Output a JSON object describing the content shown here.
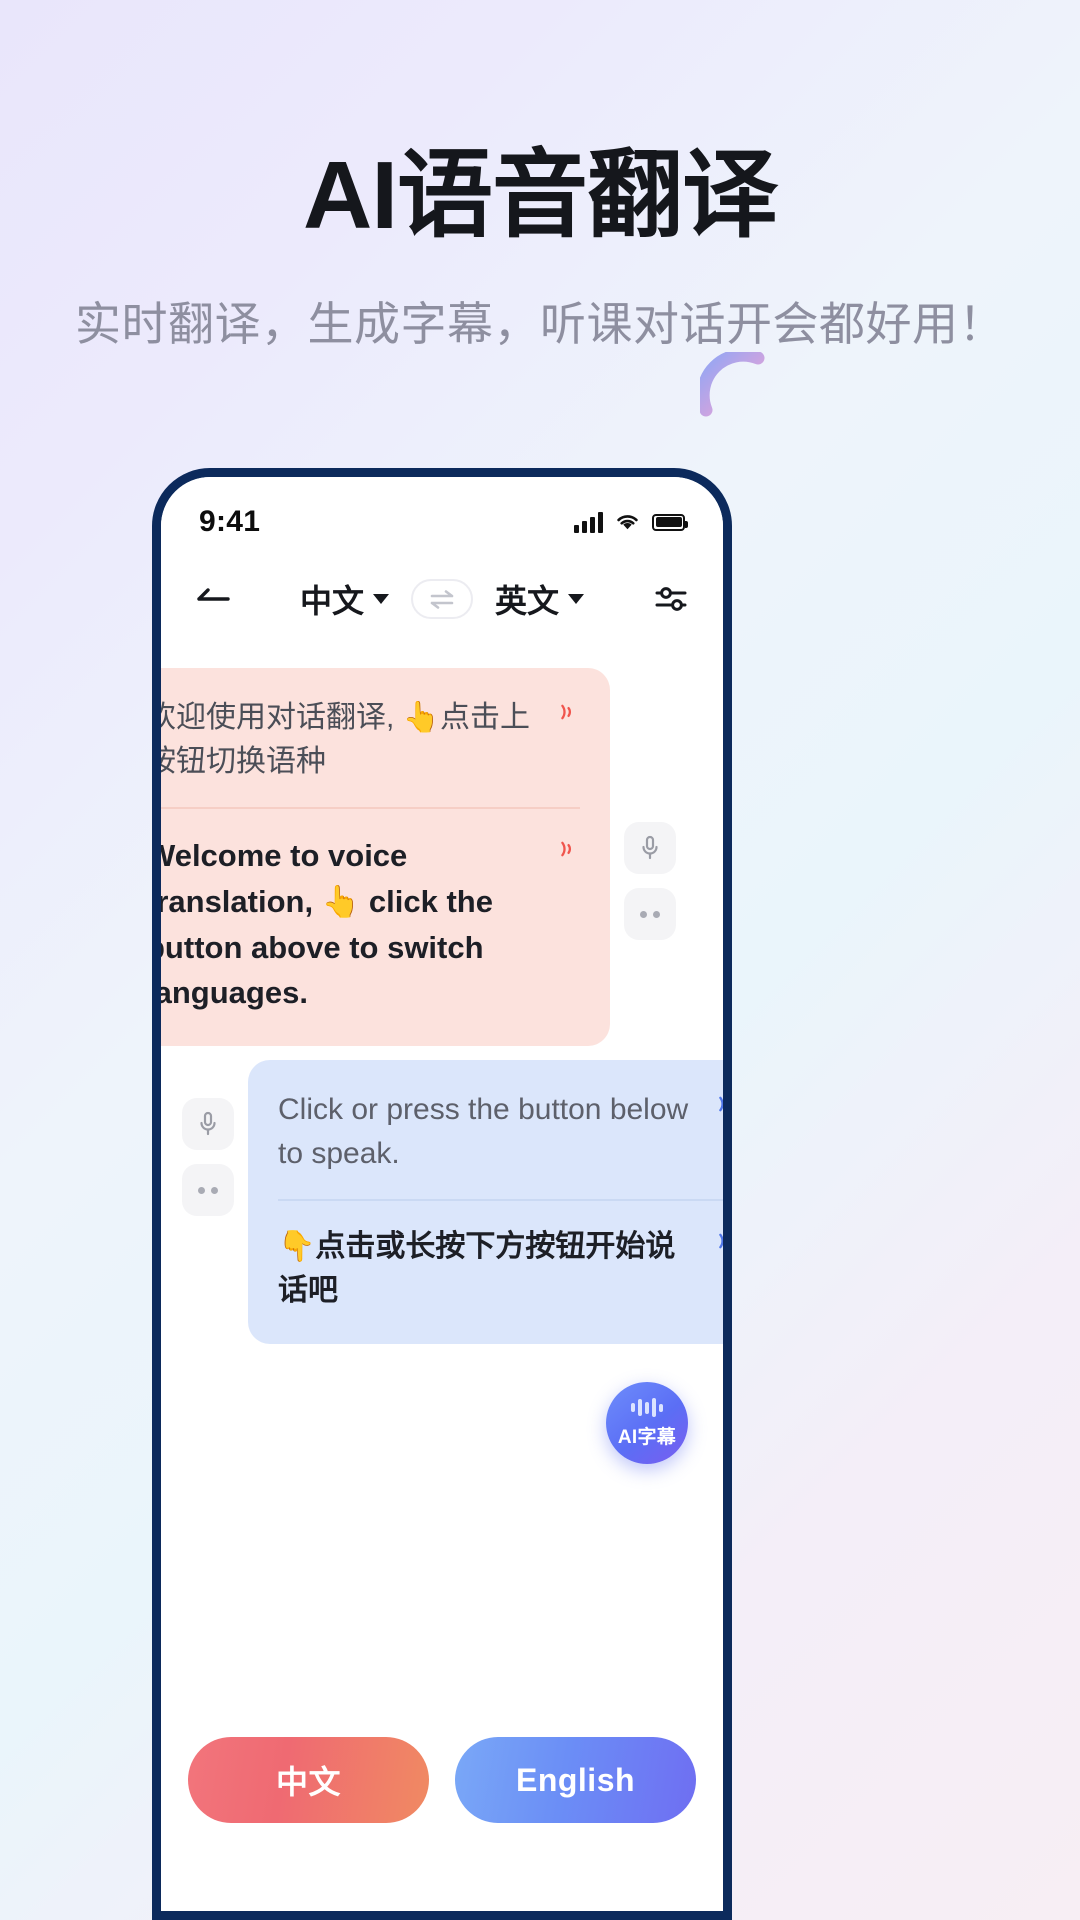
{
  "promo": {
    "title": "AI语音翻译",
    "subtitle": "实时翻译，生成字幕，听课对话开会都好用！"
  },
  "statusbar": {
    "time": "9:41",
    "signal_icon": "cellular-signal-icon",
    "wifi_icon": "wifi-icon",
    "battery_icon": "battery-icon"
  },
  "navbar": {
    "back_icon": "back-arrow-icon",
    "source_language": "中文",
    "target_language": "英文",
    "swap_icon": "swap-languages-icon",
    "settings_icon": "settings-sliders-icon"
  },
  "chat": {
    "messages": [
      {
        "side": "left",
        "color": "#fce2dd",
        "source_text": "欢迎使用对话翻译, 👆点击上按钮切换语种",
        "translated_text": "Welcome to voice translation, 👆 click the button above to switch languages.",
        "speaker_icon": "speaker-play-icon",
        "mic_icon": "microphone-icon",
        "more_icon": "more-options-icon"
      },
      {
        "side": "right",
        "color": "#dbe6fb",
        "source_text": "Click or press the button below to speak.",
        "translated_text": "👇点击或长按下方按钮开始说话吧",
        "speaker_icon": "speaker-play-icon",
        "mic_icon": "microphone-icon",
        "more_icon": "more-options-icon"
      }
    ]
  },
  "fab": {
    "label": "AI字幕",
    "icon": "audio-waveform-icon"
  },
  "bottom": {
    "left_button": "中文",
    "right_button": "English"
  },
  "colors": {
    "pink_bubble": "#fce2dd",
    "blue_bubble": "#dbe6fb",
    "phone_frame": "#0c2a5c",
    "accent_red": "#f0696f",
    "accent_blue": "#6b8ef6"
  }
}
